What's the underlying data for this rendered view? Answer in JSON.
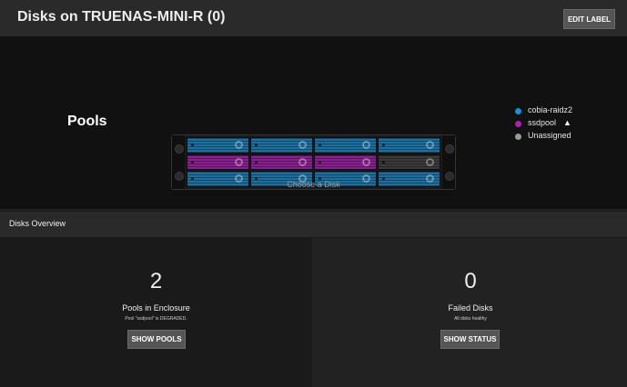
{
  "header": {
    "title": "Disks on TRUENAS-MINI-R (0)",
    "edit_label": "EDIT LABEL"
  },
  "enclosure": {
    "pools_label": "Pools",
    "choose_text": "Choose a Disk",
    "bay_rows": [
      [
        "cobia-raidz2",
        "cobia-raidz2",
        "cobia-raidz2",
        "cobia-raidz2"
      ],
      [
        "ssdpool",
        "ssdpool",
        "ssdpool",
        "Unassigned"
      ],
      [
        "cobia-raidz2",
        "cobia-raidz2",
        "cobia-raidz2",
        "cobia-raidz2"
      ]
    ],
    "legend": [
      {
        "label": "cobia-raidz2",
        "color": "#1a8fd1",
        "warning": false
      },
      {
        "label": "ssdpool",
        "color": "#b51cb5",
        "warning": true
      },
      {
        "label": "Unassigned",
        "color": "#9a9a9a",
        "warning": false
      }
    ],
    "pool_colors": {
      "cobia-raidz2": "#1c6f9e",
      "ssdpool": "#8a1f8f",
      "Unassigned": "#3a3a3a"
    }
  },
  "overview": {
    "title": "Disks Overview",
    "pools": {
      "value": "2",
      "label": "Pools in Enclosure",
      "sub": "Pool \"ssdpool\" is DEGRADED.",
      "button": "SHOW POOLS"
    },
    "failed": {
      "value": "0",
      "label": "Failed Disks",
      "sub": "All disks healthy",
      "button": "SHOW STATUS"
    }
  }
}
